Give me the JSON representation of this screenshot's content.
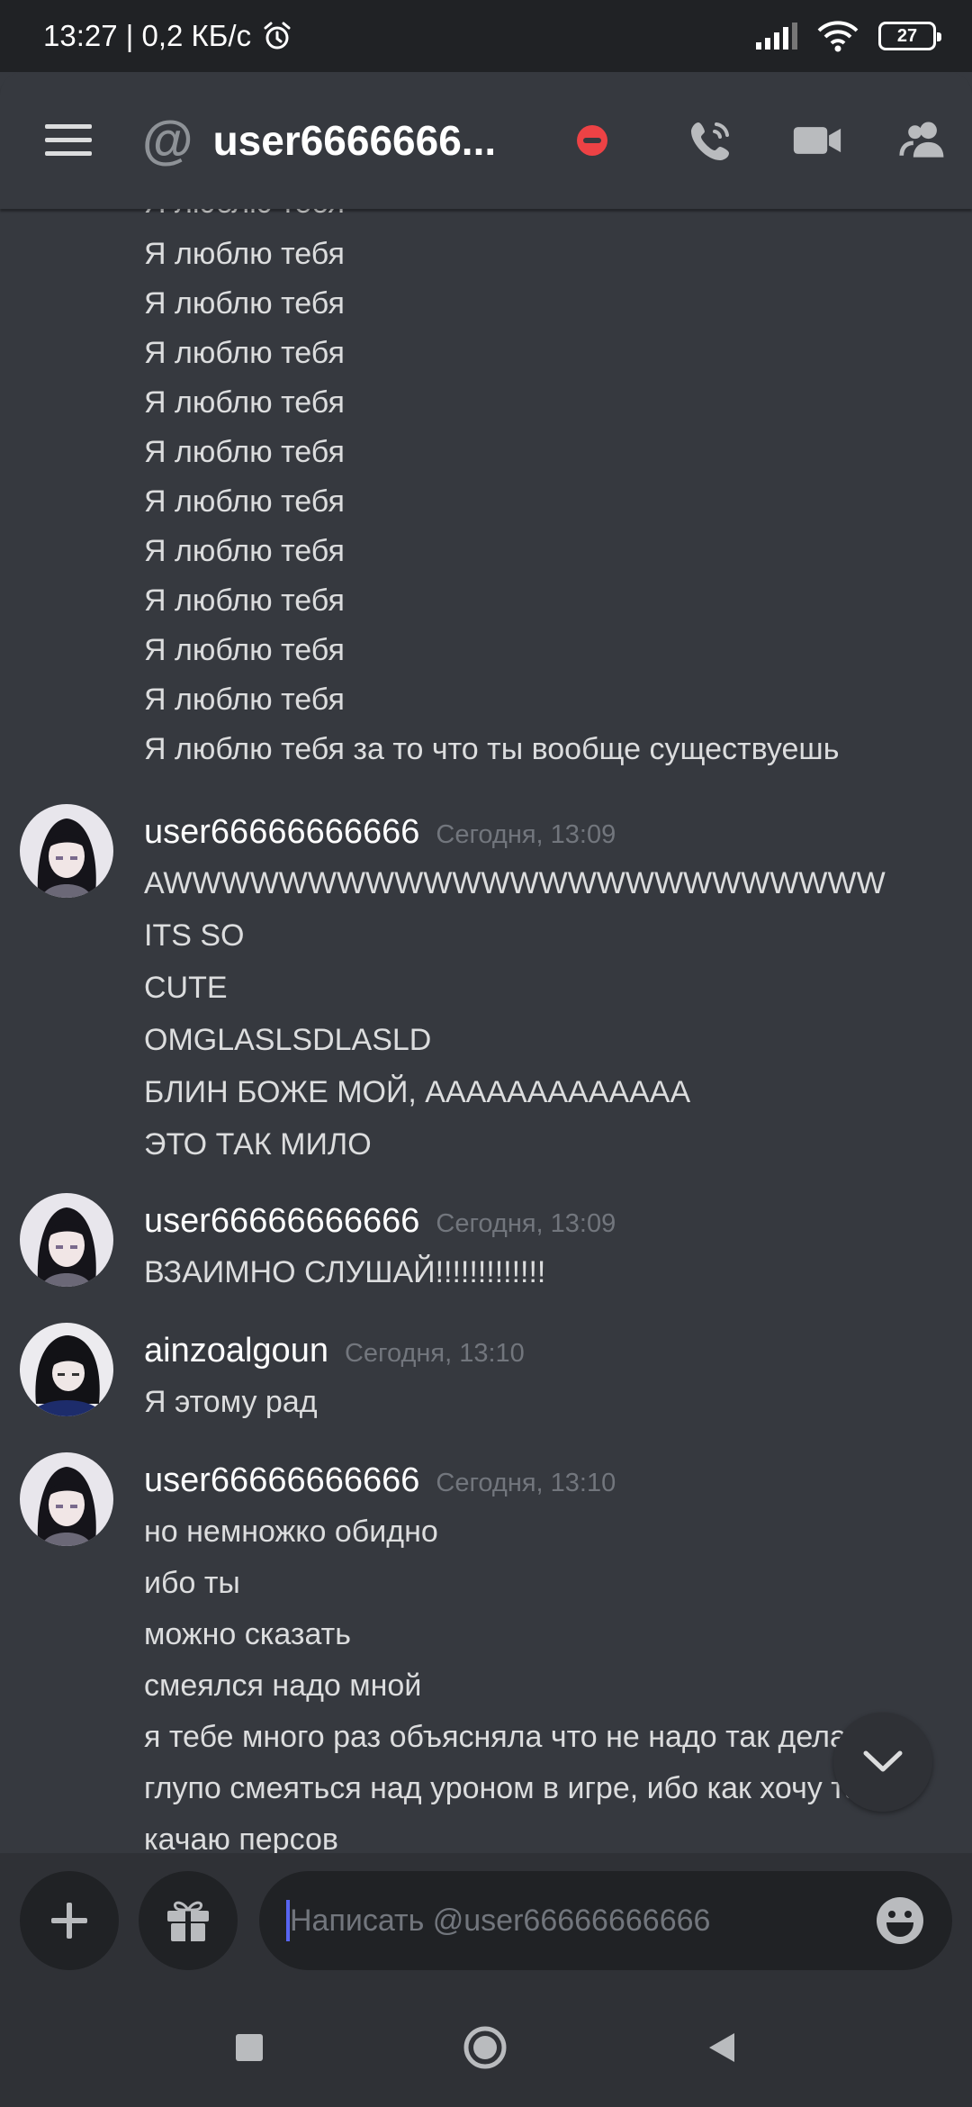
{
  "status_bar": {
    "time_speed": "13:27 | 0,2 КБ/с",
    "battery": "27"
  },
  "header": {
    "title": "user6666666...",
    "icons": [
      "menu-icon",
      "at-icon",
      "dnd-status-icon",
      "voice-call-icon",
      "video-call-icon",
      "members-icon"
    ]
  },
  "top_messages": [
    "Я люблю тебя",
    "Я люблю тебя",
    "Я люблю тебя",
    "Я люблю тебя",
    "Я люблю тебя",
    "Я люблю тебя",
    "Я люблю тебя",
    "Я люблю тебя",
    "Я люблю тебя",
    "Я люблю тебя",
    "Я люблю тебя",
    "Я люблю тебя за то что ты вообще существуешь"
  ],
  "groups": [
    {
      "author": "user66666666666",
      "time": "Сегодня, 13:09",
      "lines": [
        "AWWWWWWWWWWWWWWWWWWWWWWWWW",
        "ITS SO",
        "CUTE",
        "OMGLASLSDLASLD",
        "БЛИН БОЖЕ МОЙ, ААААААААААААА",
        "ЭТО ТАК МИЛО"
      ]
    },
    {
      "author": "user66666666666",
      "time": "Сегодня, 13:09",
      "lines": [
        "ВЗАИМНО СЛУШАЙ!!!!!!!!!!!!!"
      ]
    },
    {
      "author": "ainzoalgoun",
      "time": "Сегодня, 13:10",
      "lines": [
        "Я этому рад"
      ]
    },
    {
      "author": "user66666666666",
      "time": "Сегодня, 13:10",
      "lines": [
        "но немножко обидно",
        "ибо ты",
        "можно сказать",
        "смеялся надо мной",
        "я тебе много раз объясняла что не надо так делать",
        "глупо смеяться над уроном в игре, ибо как хочу так и",
        "качаю персов"
      ]
    }
  ],
  "input": {
    "placeholder": "Написать @user66666666666"
  },
  "colors": {
    "background": "#36393f",
    "input_bar": "#2f3136",
    "accent": "#5865f2",
    "dnd": "#ed4245"
  }
}
